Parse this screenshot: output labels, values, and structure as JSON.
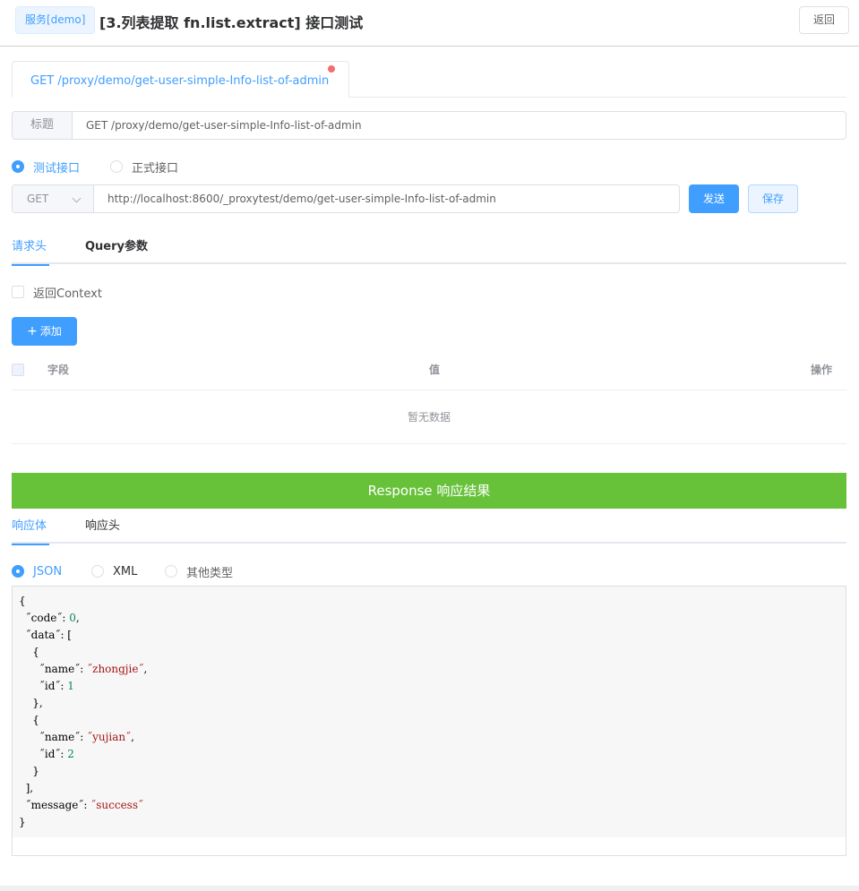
{
  "header": {
    "service_tag": "服务[demo]",
    "title": "[3.列表提取 fn.list.extract] 接口测试",
    "back_label": "返回"
  },
  "tab": {
    "label": "GET /proxy/demo/get-user-simple-Info-list-of-admin"
  },
  "title_field": {
    "label": "标题",
    "value": "GET /proxy/demo/get-user-simple-Info-list-of-admin"
  },
  "mode": {
    "test_label": "测试接口",
    "prod_label": "正式接口",
    "selected": "test"
  },
  "request": {
    "method": "GET",
    "url": "http://localhost:8600/_proxytest/demo/get-user-simple-Info-list-of-admin",
    "send_label": "发送",
    "save_label": "保存"
  },
  "request_tabs": {
    "headers_label": "请求头",
    "query_label": "Query参数",
    "active": "headers"
  },
  "return_context_label": "返回Context",
  "add_label": "添加",
  "table": {
    "col_field": "字段",
    "col_value": "值",
    "col_action": "操作",
    "empty_text": "暂无数据"
  },
  "response": {
    "bar_label": "Response 响应结果",
    "tabs": {
      "body_label": "响应体",
      "headers_label": "响应头",
      "active": "body"
    },
    "types": {
      "json_label": "JSON",
      "xml_label": "XML",
      "other_label": "其他类型",
      "selected": "json"
    },
    "body": {
      "code": 0,
      "data": [
        {
          "name": "zhongjie",
          "id": 1
        },
        {
          "name": "yujian",
          "id": 2
        }
      ],
      "message": "success"
    }
  },
  "colors": {
    "primary": "#409eff",
    "success": "#67c23a",
    "danger_dot": "#f56c6c"
  },
  "icons": {
    "add": "plus-icon",
    "select": "chevron-down-icon"
  }
}
